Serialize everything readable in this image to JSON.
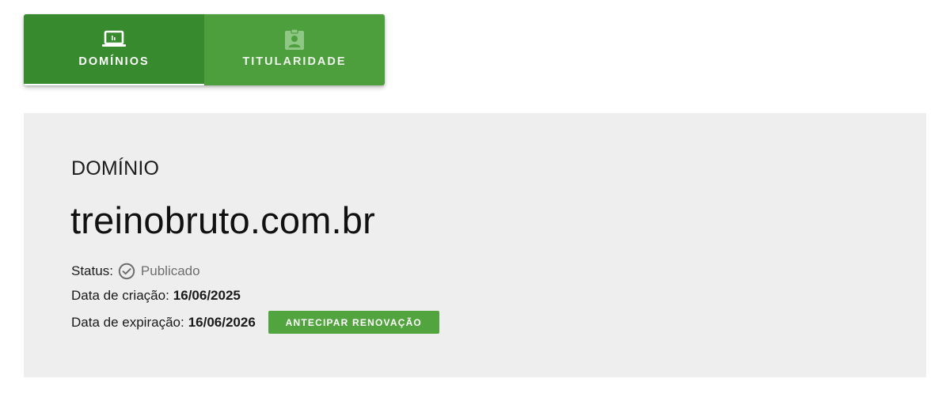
{
  "tabs": [
    {
      "label": "DOMÍNIOS",
      "icon": "laptop-icon",
      "active": true
    },
    {
      "label": "TITULARIDADE",
      "icon": "badge-icon",
      "active": false
    }
  ],
  "colors": {
    "tab_active": "#388a2e",
    "tab_inactive": "#4d9e3c",
    "button": "#52a43e",
    "panel_bg": "#eeeeee"
  },
  "domain": {
    "section_label": "DOMÍNIO",
    "name": "treinobruto.com.br",
    "status_label": "Status:",
    "status_icon": "check-circle-icon",
    "status_value": "Publicado",
    "created_label": "Data de criação:",
    "created_value": "16/06/2025",
    "expires_label": "Data de expiração:",
    "expires_value": "16/06/2026",
    "renew_button_label": "ANTECIPAR RENOVAÇÃO"
  }
}
